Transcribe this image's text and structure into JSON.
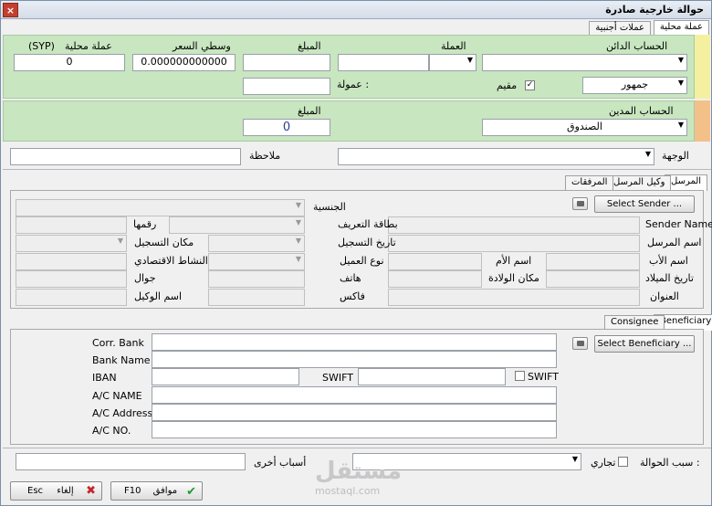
{
  "window": {
    "title": "حوالة خارجية صادرة",
    "close": "×"
  },
  "tabs_top": [
    "عملة محلية",
    "عملات أجنبية"
  ],
  "credit": {
    "account_label": "الحساب الدائن",
    "account_value": "",
    "currency_label": "العملة",
    "amount_label": "المبلغ",
    "avg_price_label": "وسطي السعر",
    "avg_price_value": "0.000000000000",
    "local_currency_label": "عملة محلية",
    "local_currency_unit": "(SYP)",
    "local_value": "0",
    "commission_label": "عمولة :",
    "resident_label": "مقيم",
    "resident_checked": "✓",
    "public_label": "جمهور"
  },
  "debit": {
    "account_label": "الحساب المدين",
    "account_value": "الصندوق",
    "amount_label": "المبلغ",
    "amount_value": "0"
  },
  "destination_label": "الوجهة",
  "note_label": "ملاحظة",
  "sender_tabs": [
    "المرسل",
    "وكيل المرسل",
    "المرفقات"
  ],
  "sender": {
    "select_btn": "Select Sender ...",
    "name_label": "Sender Name",
    "sender_name_label": "اسم المرسل",
    "father_label": "اسم الأب",
    "mother_label": "اسم الأم",
    "birth_date_label": "تاريخ الميلاد",
    "birth_place_label": "مكان الولادة",
    "address_label": "العنوان",
    "nationality_label": "الجنسية",
    "id_card_label": "بطاقة التعريف",
    "number_label": "رقمها",
    "reg_date_label": "تاريخ التسجيل",
    "reg_place_label": "مكان التسجيل",
    "client_type_label": "نوع العميل",
    "economic_label": "النشاط الاقتصادي",
    "phone_label": "هاتف",
    "mobile_label": "جوال",
    "fax_label": "فاكس",
    "agent_name_label": "اسم الوكيل"
  },
  "beneficiary_tabs": [
    "Beneficiary",
    "Consignee"
  ],
  "beneficiary": {
    "select_btn": "Select Beneficiary ...",
    "corr_bank": "Corr. Bank",
    "bank_name": "Bank Name",
    "iban": "IBAN",
    "swift": "SWIFT",
    "swift_chk": "SWIFT",
    "ac_name": "A/C NAME",
    "ac_address": "A/C Address",
    "ac_no": "A/C NO."
  },
  "reason_label": "سبب الحوالة :",
  "commercial_label": "تجاري",
  "other_reasons_label": "أسباب أخرى",
  "buttons": {
    "ok": "موافق",
    "ok_key": "F10",
    "cancel": "إلغاء",
    "cancel_key": "Esc"
  },
  "watermark": "مستقل",
  "watermark_url": "mostaql.com",
  "colors": {
    "green": "#c8e6c0",
    "yellow": "#f5f0a0",
    "orange": "#f4c08a"
  }
}
